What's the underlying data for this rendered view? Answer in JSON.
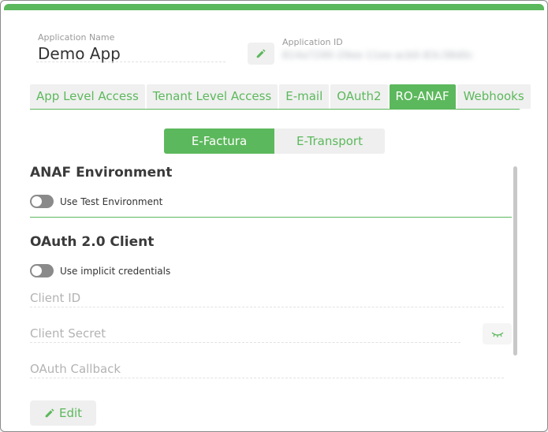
{
  "app": {
    "name_label": "Application Name",
    "name_value": "Demo App",
    "id_label": "Application ID",
    "id_value": "814a7290-29ee-11ee-acb0-83c38d0c"
  },
  "tabs": [
    {
      "label": "App Level Access",
      "active": false
    },
    {
      "label": "Tenant Level Access",
      "active": false
    },
    {
      "label": "E-mail",
      "active": false
    },
    {
      "label": "OAuth2",
      "active": false
    },
    {
      "label": "RO-ANAF",
      "active": true
    },
    {
      "label": "Webhooks",
      "active": false
    }
  ],
  "segments": [
    {
      "label": "E-Factura",
      "active": true
    },
    {
      "label": "E-Transport",
      "active": false
    }
  ],
  "anaf": {
    "title": "ANAF Environment",
    "test_env_label": "Use Test Environment",
    "test_env_on": false
  },
  "oauth": {
    "title": "OAuth 2.0 Client",
    "implicit_label": "Use implicit credentials",
    "implicit_on": false,
    "client_id_placeholder": "Client ID",
    "client_secret_placeholder": "Client Secret",
    "callback_placeholder": "OAuth Callback"
  },
  "actions": {
    "edit_label": "Edit"
  },
  "colors": {
    "accent": "#5cb85c",
    "toggle_off": "#8a8a8a"
  }
}
